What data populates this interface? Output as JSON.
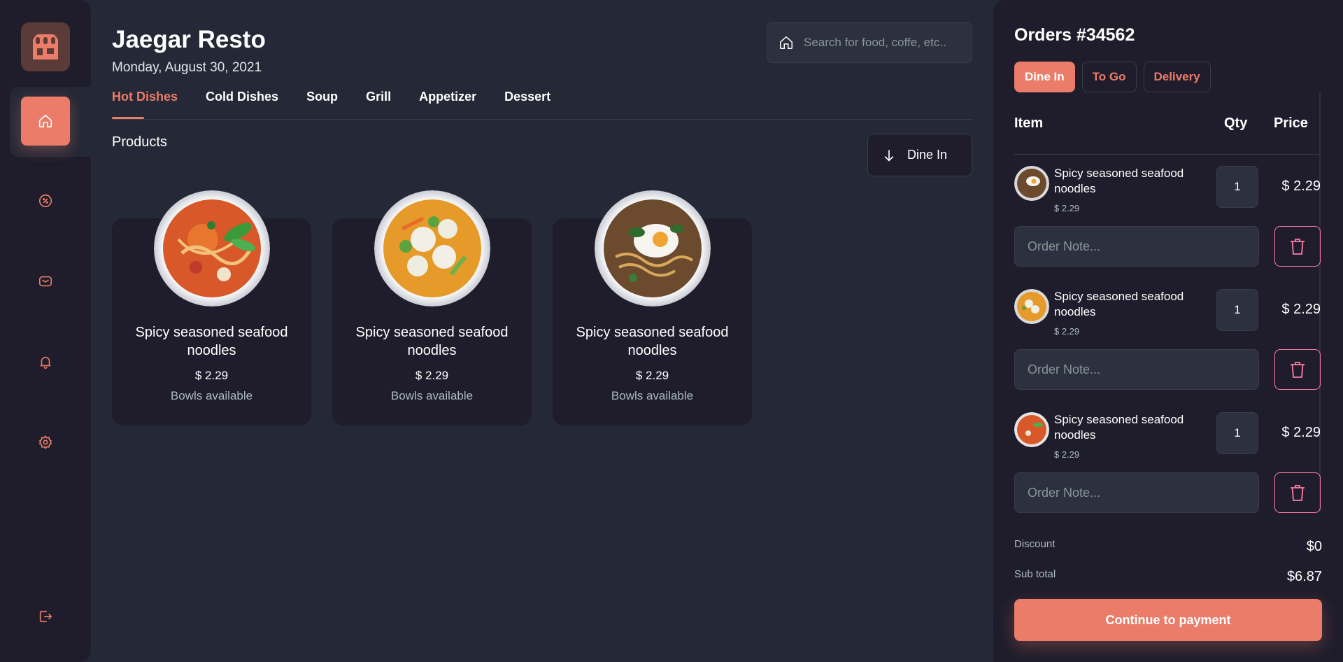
{
  "colors": {
    "accent": "#ea7c69",
    "bg": "#252836",
    "panel": "#1f1d2b",
    "danger": "#ff7ca3"
  },
  "sidebar": {
    "icons": [
      "restaurant-logo-icon",
      "home-icon",
      "discount-icon",
      "message-icon",
      "notification-icon",
      "settings-icon",
      "logout-icon"
    ],
    "active": "home"
  },
  "header": {
    "title": "Jaegar Resto",
    "date": "Monday, August 30, 2021",
    "search_placeholder": "Search for food, coffe, etc.."
  },
  "tabs": [
    "Hot Dishes",
    "Cold Dishes",
    "Soup",
    "Grill",
    "Appetizer",
    "Dessert"
  ],
  "active_tab": "Hot Dishes",
  "products": {
    "title": "Products",
    "filter_label": "Dine In",
    "items": [
      {
        "name": "Spicy seasoned seafood noodles",
        "price": "$ 2.29",
        "availability": "Bowls available"
      },
      {
        "name": "Spicy seasoned seafood noodles",
        "price": "$ 2.29",
        "availability": "Bowls available"
      },
      {
        "name": "Spicy seasoned seafood noodles",
        "price": "$ 2.29",
        "availability": "Bowls available"
      }
    ]
  },
  "orders": {
    "title": "Orders #34562",
    "tabs": [
      "Dine In",
      "To Go",
      "Delivery"
    ],
    "active_tab": "Dine In",
    "columns": {
      "item": "Item",
      "qty": "Qty",
      "price": "Price"
    },
    "items": [
      {
        "name": "Spicy seasoned seafood noodles",
        "unit_price": "$ 2.29",
        "qty": "1",
        "total": "$ 2.29",
        "note_placeholder": "Order Note..."
      },
      {
        "name": "Spicy seasoned seafood noodles",
        "unit_price": "$ 2.29",
        "qty": "1",
        "total": "$ 2.29",
        "note_placeholder": "Order Note..."
      },
      {
        "name": "Spicy seasoned seafood noodles",
        "unit_price": "$ 2.29",
        "qty": "1",
        "total": "$ 2.29",
        "note_placeholder": "Order Note..."
      }
    ],
    "discount_label": "Discount",
    "discount_value": "$0",
    "subtotal_label": "Sub total",
    "subtotal_value": "$6.87",
    "pay_label": "Continue to payment"
  }
}
